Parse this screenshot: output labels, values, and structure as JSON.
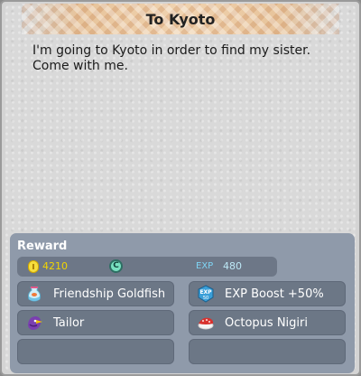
{
  "quest": {
    "title": "To Kyoto",
    "description": "I'm going to Kyoto in order to find my sister.\nCome with me."
  },
  "reward": {
    "header": "Reward",
    "gold": "4210",
    "exp_label": "EXP",
    "exp": "480",
    "items": [
      {
        "label": "Friendship Goldfish",
        "icon": "goldfish-bag-icon"
      },
      {
        "label": "EXP Boost +50%",
        "icon": "exp-boost-icon",
        "icon_text": "EXP\n50"
      },
      {
        "label": "Tailor",
        "icon": "tailor-bird-icon"
      },
      {
        "label": "Octopus Nigiri",
        "icon": "octopus-nigiri-icon"
      },
      {
        "label": "",
        "icon": ""
      },
      {
        "label": "",
        "icon": ""
      }
    ]
  },
  "colors": {
    "gold": "#f2d500",
    "exp": "#7fd4f4",
    "panel": "#8f9aaa",
    "slot": "#6c7786"
  }
}
